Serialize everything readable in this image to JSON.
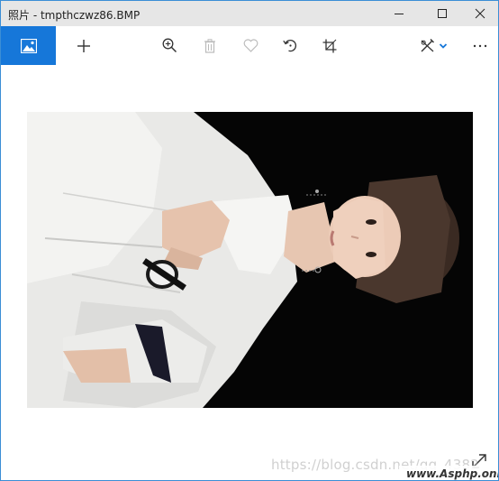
{
  "window": {
    "title": "照片 - tmpthczwz86.BMP"
  },
  "title_controls": [
    "minimize-icon",
    "maximize-icon",
    "close-icon"
  ],
  "toolbar": {
    "items": [
      {
        "name": "view-image-icon",
        "active": true
      },
      {
        "name": "add-icon"
      },
      {
        "name": "zoom-in-icon"
      },
      {
        "name": "delete-icon",
        "disabled": true
      },
      {
        "name": "favorite-icon",
        "disabled": true
      },
      {
        "name": "rotate-icon"
      },
      {
        "name": "crop-icon"
      },
      {
        "name": "edit-create-icon"
      },
      {
        "name": "chevron-down-icon"
      },
      {
        "name": "more-icon"
      }
    ],
    "accent_color": "#1677d9"
  },
  "content": {
    "photo": "portrait-photo",
    "expand": "expand-icon"
  },
  "watermark": {
    "text": "https://blog.csdn.net/qq_4382",
    "badge": "www.Asphp.online"
  }
}
